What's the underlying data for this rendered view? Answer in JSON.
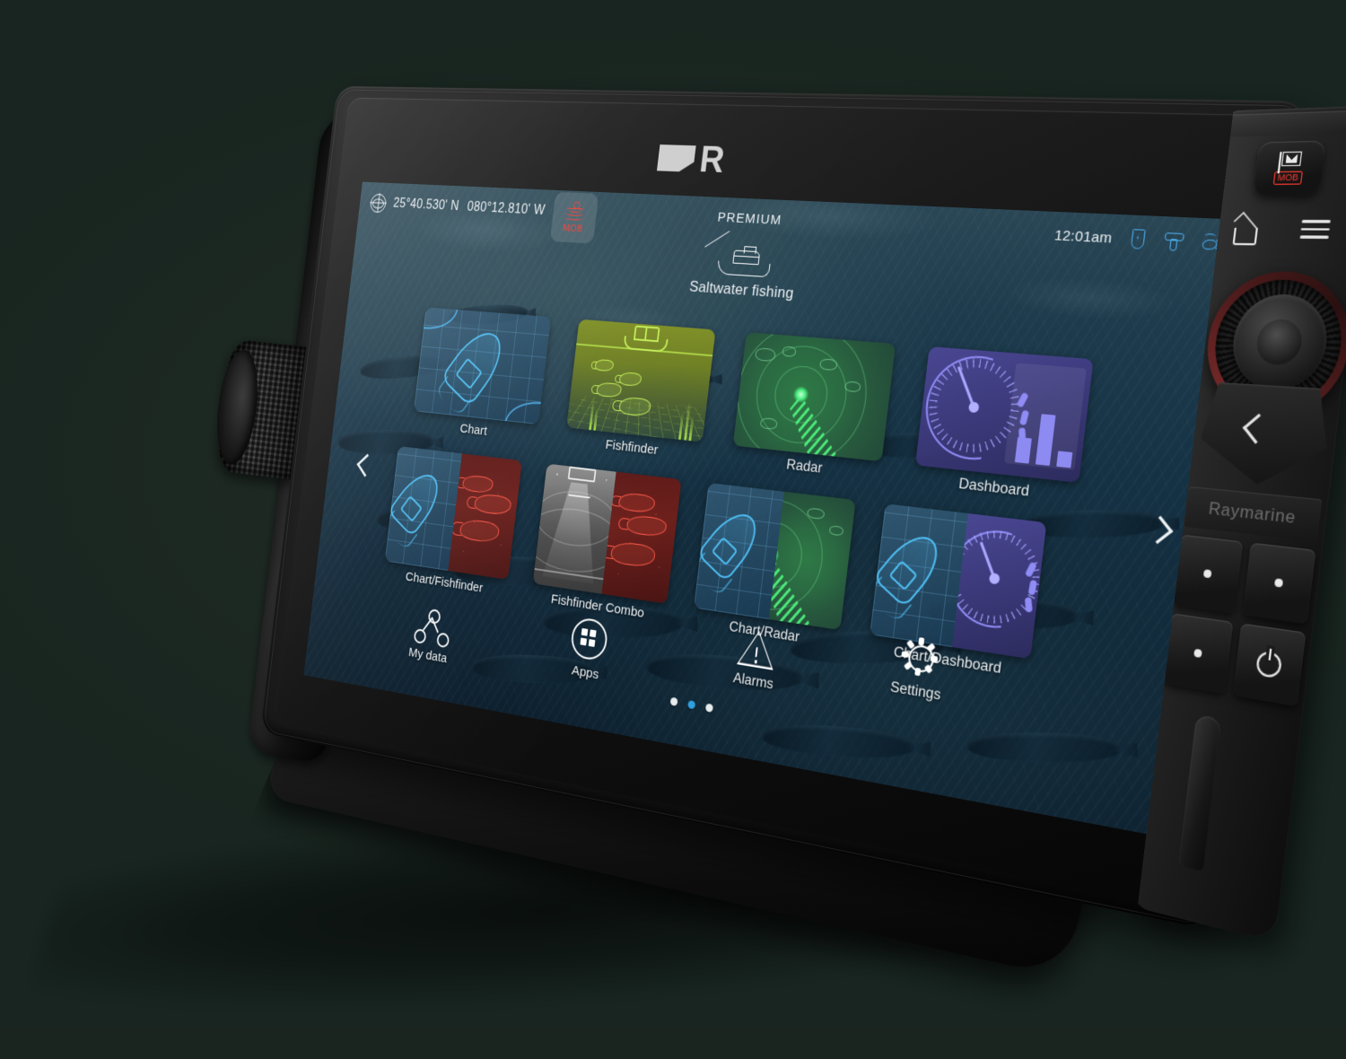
{
  "device": {
    "brand": "Raymarine",
    "logo_letter": "R",
    "accent_color": "#2f9fe0",
    "mob_color": "#ff3b30"
  },
  "status_bar": {
    "globe_icon": "globe-icon",
    "latitude": "25°40.530' N",
    "longitude": "080°12.810' W",
    "mob": {
      "label": "MOB",
      "icon": "man-overboard-icon"
    },
    "chart_tier": "PREMIUM",
    "time": "12:01am",
    "icons": [
      {
        "name": "gps-status-icon",
        "color": "#4aa8e8"
      },
      {
        "name": "transducer-status-icon",
        "color": "#4aa8e8"
      },
      {
        "name": "fish-status-icon",
        "color": "#4aa8e8"
      }
    ]
  },
  "profile": {
    "name": "Saltwater fishing",
    "icon": "sportfishing-boat-icon"
  },
  "apps": {
    "row1": [
      {
        "label": "Chart",
        "icon": "chart-app-icon",
        "type": "chart"
      },
      {
        "label": "Fishfinder",
        "icon": "fishfinder-app-icon",
        "type": "fishfinder"
      },
      {
        "label": "Radar",
        "icon": "radar-app-icon",
        "type": "radar"
      },
      {
        "label": "Dashboard",
        "icon": "dashboard-app-icon",
        "type": "dashboard"
      }
    ],
    "row2": [
      {
        "label": "Chart/Fishfinder",
        "icon": "chart-fishfinder-combo-icon",
        "type": "combo"
      },
      {
        "label": "Fishfinder Combo",
        "icon": "fishfinder-combo-icon",
        "type": "combo"
      },
      {
        "label": "Chart/Radar",
        "icon": "chart-radar-combo-icon",
        "type": "combo"
      },
      {
        "label": "Chart/Dashboard",
        "icon": "chart-dashboard-combo-icon",
        "type": "combo"
      }
    ]
  },
  "pager": {
    "total": 3,
    "active_index": 2,
    "prev_icon": "chevron-left-icon",
    "next_icon": "chevron-right-icon"
  },
  "toolbar": [
    {
      "label": "My data",
      "icon": "my-data-icon"
    },
    {
      "label": "Apps",
      "icon": "apps-grid-icon"
    },
    {
      "label": "Alarms",
      "icon": "alarm-warning-icon"
    },
    {
      "label": "Settings",
      "icon": "settings-gear-icon"
    }
  ],
  "bezel": {
    "waypoint_button": {
      "icon": "waypoint-flag-icon",
      "mob_label": "MOB"
    },
    "home_icon": "home-icon",
    "menu_icon": "menu-hamburger-icon",
    "rotary": "unicontroller-rotary-knob",
    "back_icon": "back-chevron-icon",
    "brand_text": "Raymarine",
    "power_icon": "power-icon",
    "keys": [
      "dot-key",
      "dot-key",
      "dot-key"
    ]
  }
}
